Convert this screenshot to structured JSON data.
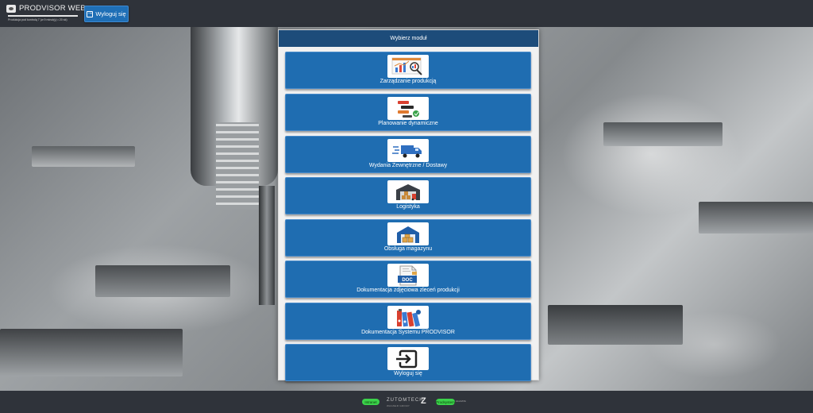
{
  "brand": {
    "name": "PRODVISOR WEB",
    "tagline": "Produkcja pod kontrolą 7 (w 9 minut(y) • 20 sk)"
  },
  "header": {
    "logout_label": "Wyloguj się"
  },
  "panel": {
    "title": "Wybierz moduł",
    "modules": [
      {
        "label": "Zarządzanie produkcją",
        "icon": "production-management-icon"
      },
      {
        "label": "Planowanie dynamiczne",
        "icon": "dynamic-planning-icon"
      },
      {
        "label": "Wydania Zewnętrzne / Dostawy",
        "icon": "delivery-truck-icon"
      },
      {
        "label": "Logistyka",
        "icon": "logistics-warehouse-icon"
      },
      {
        "label": "Obsługa magazynu",
        "icon": "warehouse-icon"
      },
      {
        "label": "Dokumentacja zdjęciowa zleceń produkcji",
        "icon": "doc-file-icon"
      },
      {
        "label": "Dokumentacja Systemu PRODVISOR",
        "icon": "binders-icon"
      },
      {
        "label": "Wyloguj się",
        "icon": "logout-icon"
      }
    ]
  },
  "footer": {
    "left_badge": "Intranet",
    "company": "ZUTOMTECH",
    "company_sub": "WAGNER GROUP",
    "right_badge": "Prodsystem",
    "right_small": "ALLDATA"
  },
  "colors": {
    "accent": "#1f6db1",
    "header": "#1d4c7a",
    "topbar": "#2f333a",
    "badge": "#3bd24a"
  }
}
